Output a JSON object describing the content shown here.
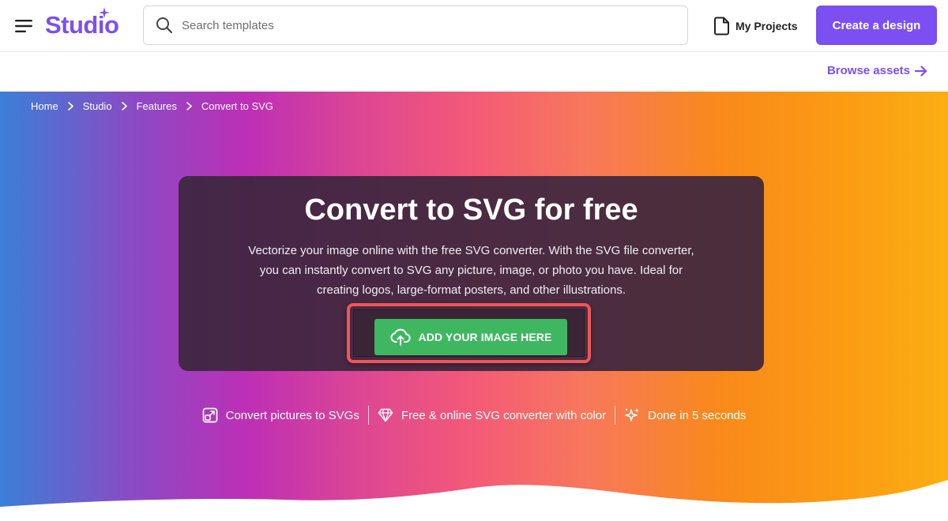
{
  "header": {
    "logo_text": "Studio",
    "search": {
      "placeholder": "Search templates",
      "value": ""
    },
    "my_projects_label": "My Projects",
    "create_label": "Create a design"
  },
  "subbar": {
    "browse_label": "Browse assets"
  },
  "breadcrumb": [
    "Home",
    "Studio",
    "Features",
    "Convert to SVG"
  ],
  "hero": {
    "title": "Convert to SVG for free",
    "description": "Vectorize your image online with the free SVG converter. With the SVG file converter, you can instantly convert to SVG any picture, image, or photo you have. Ideal for creating logos, large-format posters, and other illustrations.",
    "upload_label": "ADD YOUR IMAGE HERE"
  },
  "features": [
    {
      "icon": "expand-square-icon",
      "label": "Convert pictures to SVGs"
    },
    {
      "icon": "diamond-icon",
      "label": "Free & online SVG converter with color"
    },
    {
      "icon": "sparkles-icon",
      "label": "Done in 5 seconds"
    }
  ],
  "colors": {
    "brand": "#7b4ff2",
    "upload_button": "#3eb760",
    "highlight_frame": "#f05656"
  }
}
